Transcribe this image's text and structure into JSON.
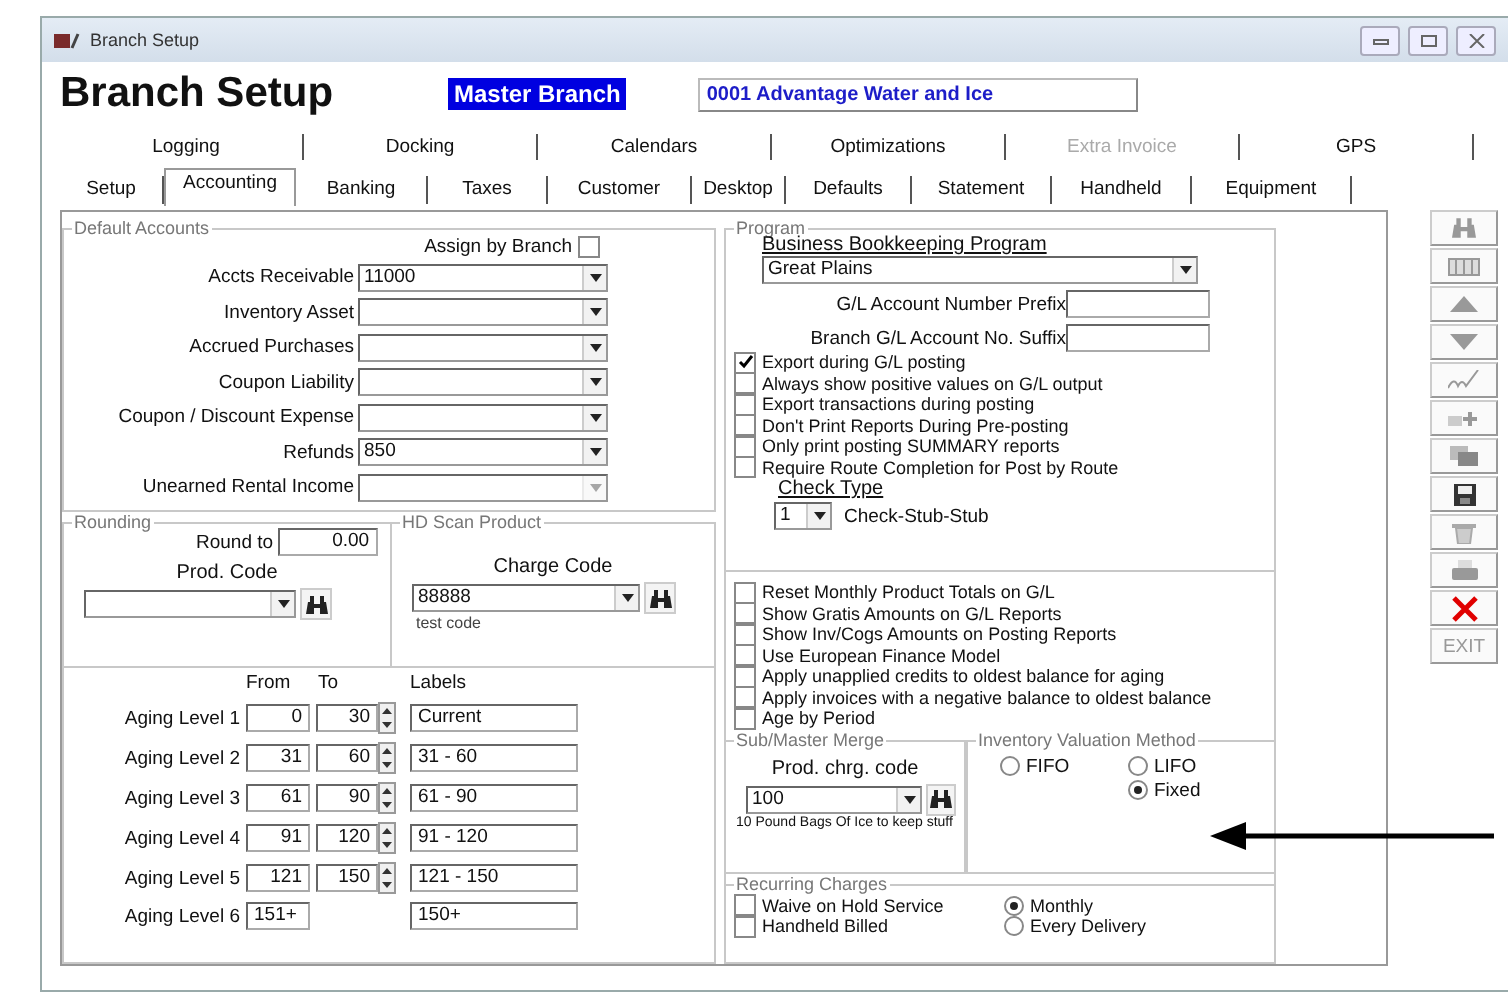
{
  "window": {
    "title": "Branch Setup"
  },
  "header": {
    "title": "Branch Setup",
    "branch_label": "Master Branch",
    "branch_field": "0001  Advantage Water and Ice"
  },
  "tabs": {
    "row_1": [
      {
        "label": "Logging",
        "selected": false,
        "disabled": false
      },
      {
        "label": "Docking",
        "selected": false,
        "disabled": false
      },
      {
        "label": "Calendars",
        "selected": false,
        "disabled": false
      },
      {
        "label": "Optimizations",
        "selected": false,
        "disabled": false
      },
      {
        "label": "Extra Invoice",
        "selected": false,
        "disabled": true
      },
      {
        "label": "GPS",
        "selected": false,
        "disabled": false
      }
    ],
    "row_2": [
      {
        "label": "Setup",
        "selected": false,
        "disabled": false
      },
      {
        "label": "Accounting",
        "selected": true,
        "disabled": false
      },
      {
        "label": "Banking",
        "selected": false,
        "disabled": false
      },
      {
        "label": "Taxes",
        "selected": false,
        "disabled": false
      },
      {
        "label": "Customer",
        "selected": false,
        "disabled": false
      },
      {
        "label": "Desktop",
        "selected": false,
        "disabled": false
      },
      {
        "label": "Defaults",
        "selected": false,
        "disabled": false
      },
      {
        "label": "Statement",
        "selected": false,
        "disabled": false
      },
      {
        "label": "Handheld",
        "selected": false,
        "disabled": false
      },
      {
        "label": "Equipment",
        "selected": false,
        "disabled": false
      }
    ]
  },
  "default_accounts": {
    "title": "Default Accounts",
    "assign_label": "Assign by Branch",
    "assign_checked": false,
    "accounts": [
      {
        "label": "Accts Receivable",
        "value": "11000",
        "disabled": false
      },
      {
        "label": "Inventory Asset",
        "disabled": false
      },
      {
        "label": "Accrued Purchases",
        "disabled": false
      },
      {
        "label": "Coupon Liability",
        "disabled": false
      },
      {
        "label": "Coupon / Discount Expense",
        "disabled": false
      },
      {
        "label": "Refunds",
        "value": "850",
        "disabled": false
      },
      {
        "label": "Unearned Rental Income",
        "disabled": true
      }
    ]
  },
  "rounding": {
    "title": "Rounding",
    "round_to_label": "Round to",
    "round_to": "0.00",
    "prod_code_label": "Prod. Code"
  },
  "scan_product": {
    "title": "HD Scan Product",
    "charge_code_label": "Charge Code",
    "charge_code": "88888",
    "note": "test code"
  },
  "aging": {
    "from_header": "From",
    "to_header": "To",
    "labels_header": "Labels",
    "levels": [
      {
        "label": "Aging Level 1",
        "from": "0",
        "to": "30",
        "text": "Current"
      },
      {
        "label": "Aging Level 2",
        "from": "31",
        "to": "60",
        "text": "31 - 60"
      },
      {
        "label": "Aging Level 3",
        "from": "61",
        "to": "90",
        "text": "61 - 90"
      },
      {
        "label": "Aging Level 4",
        "from": "91",
        "to": "120",
        "text": "91 - 120"
      },
      {
        "label": "Aging Level 5",
        "from": "121",
        "to": "150",
        "text": "121 - 150"
      },
      {
        "label": "Aging Level 6",
        "from": "151+",
        "text": "150+"
      }
    ]
  },
  "program": {
    "title": "Program",
    "bookkeeping_label": "Business Bookkeeping Program",
    "bookkeeping_value": "Great Plains",
    "prefix_label": "G/L Account Number Prefix",
    "suffix_label": "Branch G/L Account No. Suffix",
    "options": [
      {
        "label": "Export during G/L posting",
        "checked": true
      },
      {
        "label": "Always show positive values on G/L output",
        "checked": false
      },
      {
        "label": "Export transactions during posting",
        "checked": false
      },
      {
        "label": "Don't Print Reports During Pre-posting",
        "checked": false
      },
      {
        "label": "Only print posting SUMMARY reports",
        "checked": false
      },
      {
        "label": "Require Route Completion for Post by Route",
        "checked": false
      }
    ],
    "check_type_label": "Check Type",
    "check_type_value": "1",
    "check_type_text": "Check-Stub-Stub"
  },
  "options": [
    {
      "label": "Reset Monthly Product Totals on G/L",
      "checked": false
    },
    {
      "label": "Show Gratis Amounts on G/L Reports",
      "checked": false
    },
    {
      "label": "Show Inv/Cogs Amounts on Posting Reports",
      "checked": false
    },
    {
      "label": "Use European Finance Model",
      "checked": false
    },
    {
      "label": "Apply unapplied credits to oldest balance for aging",
      "checked": false
    },
    {
      "label": "Apply invoices with a negative balance to oldest balance",
      "checked": false
    },
    {
      "label": "Age by Period",
      "checked": false
    }
  ],
  "sub_master": {
    "title": "Sub/Master Merge",
    "prod_label": "Prod. chrg. code",
    "value": "100",
    "note": "10 Pound Bags Of Ice to keep stuff"
  },
  "valuation": {
    "title": "Inventory Valuation Method",
    "methods": [
      {
        "label": "FIFO",
        "selected": false
      },
      {
        "label": "LIFO",
        "selected": false
      },
      {
        "label": "Fixed",
        "selected": true
      }
    ]
  },
  "recurring": {
    "title": "Recurring Charges",
    "options": [
      {
        "label": "Waive on Hold Service",
        "checked": false
      },
      {
        "label": "Handheld Billed",
        "checked": false
      }
    ],
    "frequencies": [
      {
        "label": "Monthly",
        "selected": true
      },
      {
        "label": "Every Delivery",
        "selected": false
      }
    ]
  },
  "toolbar": {
    "exit_label": "EXIT"
  }
}
